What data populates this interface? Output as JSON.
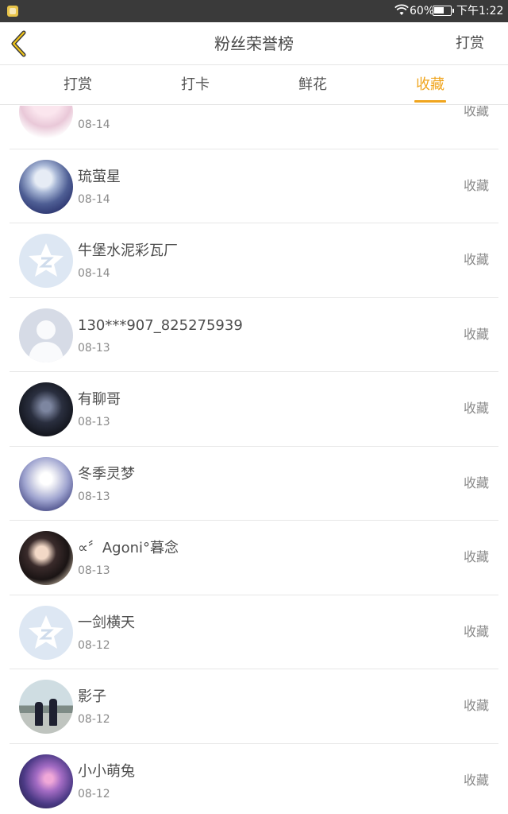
{
  "statusbar": {
    "battery": "60%",
    "time": "下午1:22"
  },
  "header": {
    "title": "粉丝荣誉榜",
    "action": "打赏"
  },
  "tabs": [
    {
      "label": "打赏",
      "active": false
    },
    {
      "label": "打卡",
      "active": false
    },
    {
      "label": "鲜花",
      "active": false
    },
    {
      "label": "收藏",
      "active": true
    }
  ],
  "colors": {
    "accent": "#f0a51e",
    "text": "#4d4d4d",
    "secondary": "#8a8a8a",
    "divider": "#e7e7e7"
  },
  "fans": [
    {
      "name": "",
      "date": "08-14",
      "action": "收藏",
      "avatar": "partial-photo"
    },
    {
      "name": "琉萤星",
      "date": "08-14",
      "action": "收藏",
      "avatar": "anime-photo"
    },
    {
      "name": "牛堡水泥彩瓦厂",
      "date": "08-14",
      "action": "收藏",
      "avatar": "qq-default"
    },
    {
      "name": "130***907_825275939",
      "date": "08-13",
      "action": "收藏",
      "avatar": "person-default"
    },
    {
      "name": "有聊哥",
      "date": "08-13",
      "action": "收藏",
      "avatar": "dark-photo"
    },
    {
      "name": "冬季灵梦",
      "date": "08-13",
      "action": "收藏",
      "avatar": "lolita-photo"
    },
    {
      "name": "∝〞Agoni°暮念",
      "date": "08-13",
      "action": "收藏",
      "avatar": "girl-photo"
    },
    {
      "name": "一剑横天",
      "date": "08-12",
      "action": "收藏",
      "avatar": "qq-default"
    },
    {
      "name": "影子",
      "date": "08-12",
      "action": "收藏",
      "avatar": "street-photo"
    },
    {
      "name": "小小萌兔",
      "date": "08-12",
      "action": "收藏",
      "avatar": "night-photo"
    }
  ]
}
